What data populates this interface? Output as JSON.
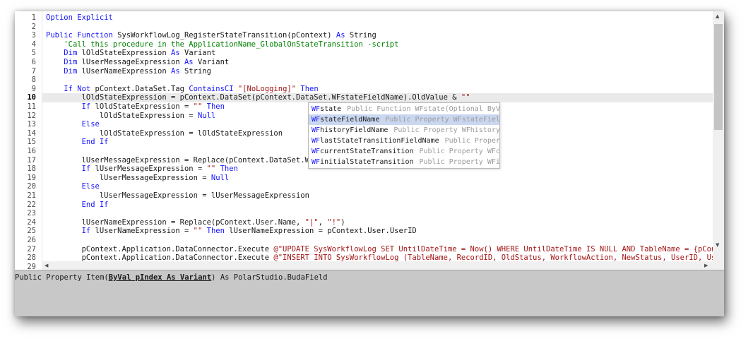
{
  "editor": {
    "current_line": 10,
    "lines": [
      [
        {
          "t": "Option Explicit",
          "c": "kw"
        }
      ],
      [],
      [
        {
          "t": "Public Function ",
          "c": "kw"
        },
        {
          "t": "SysWorkflowLog_RegisterStateTransition(pContext) "
        },
        {
          "t": "As",
          "c": "kw"
        },
        {
          "t": " String"
        }
      ],
      [
        {
          "t": "    "
        },
        {
          "t": "'Call this procedure in the ApplicationName_GlobalOnStateTransition -script",
          "c": "cm"
        }
      ],
      [
        {
          "t": "    "
        },
        {
          "t": "Dim",
          "c": "kw"
        },
        {
          "t": " lOldStateExpression "
        },
        {
          "t": "As",
          "c": "kw"
        },
        {
          "t": " Variant"
        }
      ],
      [
        {
          "t": "    "
        },
        {
          "t": "Dim",
          "c": "kw"
        },
        {
          "t": " lUserMessageExpression "
        },
        {
          "t": "As",
          "c": "kw"
        },
        {
          "t": " Variant"
        }
      ],
      [
        {
          "t": "    "
        },
        {
          "t": "Dim",
          "c": "kw"
        },
        {
          "t": " lUserNameExpression "
        },
        {
          "t": "As",
          "c": "kw"
        },
        {
          "t": " String"
        }
      ],
      [],
      [
        {
          "t": "    "
        },
        {
          "t": "If Not",
          "c": "kw"
        },
        {
          "t": " pContext.DataSet.Tag "
        },
        {
          "t": "ContainsCI",
          "c": "kw"
        },
        {
          "t": " "
        },
        {
          "t": "\"[NoLogging]\"",
          "c": "st"
        },
        {
          "t": " "
        },
        {
          "t": "Then",
          "c": "kw"
        }
      ],
      [
        {
          "t": "        lOldStateExpression = pContext.DataSet(pContext.DataSet.WFstateFieldName).OldValue & "
        },
        {
          "t": "\"\"",
          "c": "st"
        }
      ],
      [
        {
          "t": "        "
        },
        {
          "t": "If",
          "c": "kw"
        },
        {
          "t": " lOldStateExpression = "
        },
        {
          "t": "\"\"",
          "c": "st"
        },
        {
          "t": " "
        },
        {
          "t": "Then",
          "c": "kw"
        }
      ],
      [
        {
          "t": "            lOldStateExpression = "
        },
        {
          "t": "Null",
          "c": "kw"
        }
      ],
      [
        {
          "t": "        "
        },
        {
          "t": "Else",
          "c": "kw"
        }
      ],
      [
        {
          "t": "            lOldStateExpression = lOldStateExpression"
        }
      ],
      [
        {
          "t": "        "
        },
        {
          "t": "End If",
          "c": "kw"
        }
      ],
      [],
      [
        {
          "t": "        lUserMessageExpression = Replace(pContext.DataSet.WFmes"
        }
      ],
      [
        {
          "t": "        "
        },
        {
          "t": "If",
          "c": "kw"
        },
        {
          "t": " lUserMessageExpression = "
        },
        {
          "t": "\"\"",
          "c": "st"
        },
        {
          "t": " "
        },
        {
          "t": "Then",
          "c": "kw"
        }
      ],
      [
        {
          "t": "            lUserMessageExpression = "
        },
        {
          "t": "Null",
          "c": "kw"
        }
      ],
      [
        {
          "t": "        "
        },
        {
          "t": "Else",
          "c": "kw"
        }
      ],
      [
        {
          "t": "            lUserMessageExpression = lUserMessageExpression"
        }
      ],
      [
        {
          "t": "        "
        },
        {
          "t": "End If",
          "c": "kw"
        }
      ],
      [],
      [
        {
          "t": "        lUserNameExpression = Replace(pContext.User.Name, "
        },
        {
          "t": "\"|\"",
          "c": "st"
        },
        {
          "t": ", "
        },
        {
          "t": "\"!\"",
          "c": "st"
        },
        {
          "t": ")"
        }
      ],
      [
        {
          "t": "        "
        },
        {
          "t": "If",
          "c": "kw"
        },
        {
          "t": " lUserNameExpression = "
        },
        {
          "t": "\"\"",
          "c": "st"
        },
        {
          "t": " "
        },
        {
          "t": "Then",
          "c": "kw"
        },
        {
          "t": " lUserNameExpression = pContext.User.UserID"
        }
      ],
      [],
      [
        {
          "t": "        pContext.Application.DataConnector.Execute "
        },
        {
          "t": "@\"UPDATE SysWorkflowLog SET UntilDateTime = Now() WHERE UntilDateTime IS NULL AND TableName = {pContext.DataSet",
          "c": "st"
        }
      ],
      [
        {
          "t": "        pContext.Application.DataConnector.Execute "
        },
        {
          "t": "@\"INSERT INTO SysWorkflowLog (TableName, RecordID, OldStatus, WorkflowAction, NewStatus, UserID, UserName, Use",
          "c": "st"
        }
      ],
      []
    ]
  },
  "autocomplete": {
    "typed_prefix": "WF",
    "selected_index": 1,
    "items": [
      {
        "prefix": "WF",
        "rest": "state",
        "signature": "Public Function WFstate(Optional ByV"
      },
      {
        "prefix": "WF",
        "rest": "stateFieldName",
        "signature": "Public Property WFstateFiel"
      },
      {
        "prefix": "WF",
        "rest": "historyFieldName",
        "signature": "Public Property WFhistory"
      },
      {
        "prefix": "WF",
        "rest": "lastStateTransitionFieldName",
        "signature": "Public Proper"
      },
      {
        "prefix": "WF",
        "rest": "currentStateTransition",
        "signature": "Public Property WFc"
      },
      {
        "prefix": "WF",
        "rest": "initialStateTransition",
        "signature": "Public Property WFi"
      }
    ]
  },
  "status": {
    "sig_pre": "Public Property Item(",
    "sig_param": "ByVal pIndex As Variant",
    "sig_post": ") As PolarStudio.BudaField"
  },
  "icons": {
    "scroll_up": "up-arrow-icon",
    "scroll_down": "down-arrow-icon",
    "scroll_left": "left-arrow-icon",
    "scroll_right": "right-arrow-icon"
  },
  "colors": {
    "keyword": "#1515ff",
    "string": "#a31515",
    "comment": "#008000",
    "selection": "#c9d7f0",
    "status_bg": "#c8c8c8"
  }
}
